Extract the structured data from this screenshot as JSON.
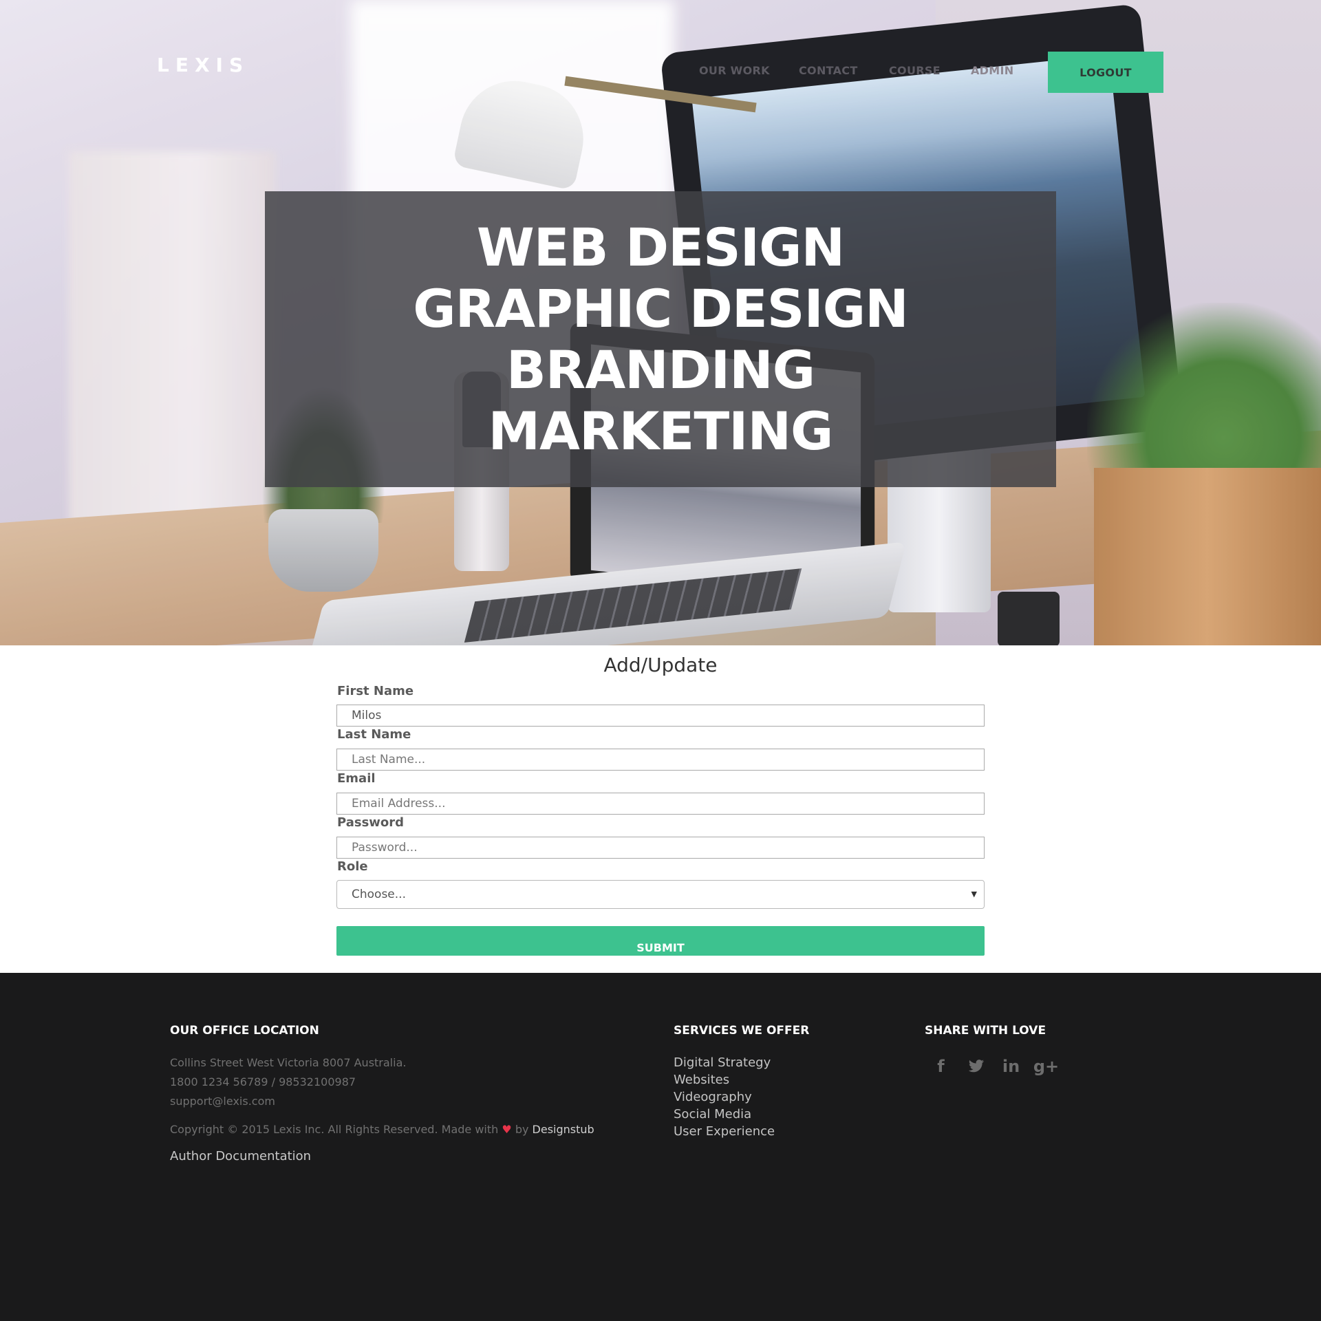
{
  "brand": {
    "logo": "LEXIS"
  },
  "nav": {
    "items": [
      {
        "label": "OUR WORK"
      },
      {
        "label": "CONTACT"
      },
      {
        "label": "COURSE"
      },
      {
        "label": "ADMIN"
      }
    ],
    "logout_label": "LOGOUT"
  },
  "hero": {
    "lines": [
      "WEB DESIGN",
      "GRAPHIC DESIGN",
      "BRANDING",
      "MARKETING"
    ]
  },
  "form": {
    "title": "Add/Update",
    "first_name": {
      "label": "First Name",
      "value": "Milos"
    },
    "last_name": {
      "label": "Last Name",
      "placeholder": "Last Name..."
    },
    "email": {
      "label": "Email",
      "placeholder": "Email Address..."
    },
    "password": {
      "label": "Password",
      "placeholder": "Password..."
    },
    "role": {
      "label": "Role",
      "selected": "Choose..."
    },
    "submit_label": "SUBMIT"
  },
  "footer": {
    "office": {
      "heading": "OUR OFFICE LOCATION",
      "address": "Collins Street West Victoria 8007 Australia.",
      "phone": "1800 1234 56789 / 98532100987",
      "email": "support@lexis.com",
      "copyright_prefix": "Copyright © 2015 Lexis Inc. All Rights Reserved. Made with",
      "copyright_by": "by",
      "copyright_brand": "Designstub",
      "author_link": "Author Documentation"
    },
    "services": {
      "heading": "SERVICES WE OFFER",
      "items": [
        "Digital Strategy",
        "Websites",
        "Videography",
        "Social Media",
        "User Experience"
      ]
    },
    "share": {
      "heading": "SHARE WITH LOVE",
      "icons": [
        "facebook-icon",
        "twitter-icon",
        "linkedin-icon",
        "google-plus-icon"
      ]
    }
  },
  "colors": {
    "accent": "#3dc28f",
    "footer_bg": "#1a1a1b",
    "heart": "#e8344a"
  }
}
